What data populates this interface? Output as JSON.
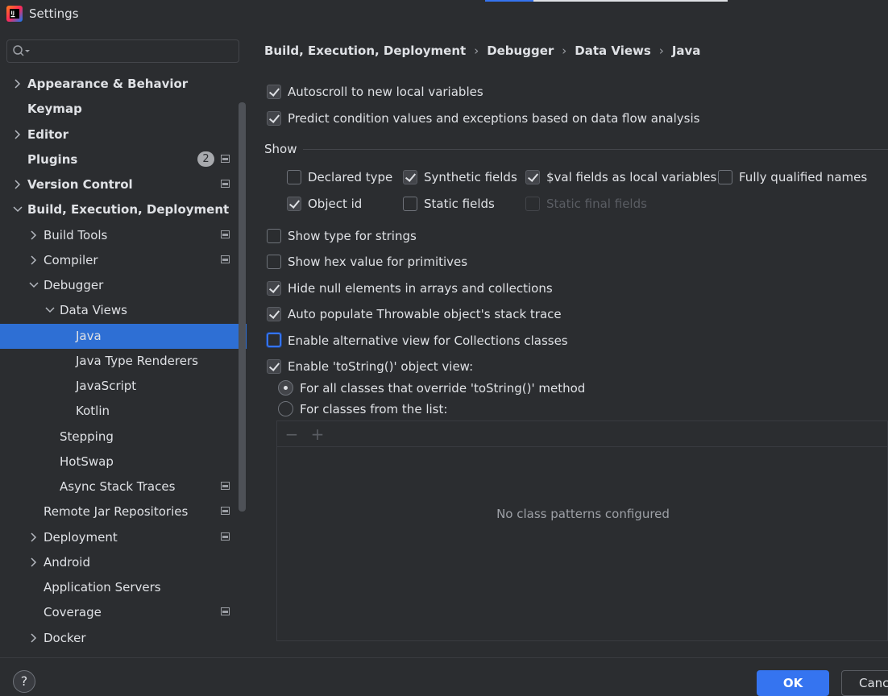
{
  "window": {
    "title": "Settings",
    "icon": "intellij-idea-icon"
  },
  "sidebar": {
    "search_placeholder": "",
    "items": [
      {
        "label": "Appearance & Behavior",
        "bold": true,
        "expandable": true,
        "expanded": false,
        "level": 0
      },
      {
        "label": "Keymap",
        "bold": true,
        "expandable": false,
        "level": 0
      },
      {
        "label": "Editor",
        "bold": true,
        "expandable": true,
        "expanded": false,
        "level": 0
      },
      {
        "label": "Plugins",
        "bold": true,
        "expandable": false,
        "level": 0,
        "badge": "2",
        "project_icon": true
      },
      {
        "label": "Version Control",
        "bold": true,
        "expandable": true,
        "expanded": false,
        "level": 0,
        "project_icon": true
      },
      {
        "label": "Build, Execution, Deployment",
        "bold": true,
        "expandable": true,
        "expanded": true,
        "level": 0
      },
      {
        "label": "Build Tools",
        "expandable": true,
        "expanded": false,
        "level": 1,
        "project_icon": true
      },
      {
        "label": "Compiler",
        "expandable": true,
        "expanded": false,
        "level": 1,
        "project_icon": true
      },
      {
        "label": "Debugger",
        "expandable": true,
        "expanded": true,
        "level": 1
      },
      {
        "label": "Data Views",
        "expandable": true,
        "expanded": true,
        "level": 2
      },
      {
        "label": "Java",
        "expandable": false,
        "level": 3,
        "selected": true
      },
      {
        "label": "Java Type Renderers",
        "expandable": false,
        "level": 3
      },
      {
        "label": "JavaScript",
        "expandable": false,
        "level": 3
      },
      {
        "label": "Kotlin",
        "expandable": false,
        "level": 3
      },
      {
        "label": "Stepping",
        "expandable": false,
        "level": 2
      },
      {
        "label": "HotSwap",
        "expandable": false,
        "level": 2
      },
      {
        "label": "Async Stack Traces",
        "expandable": false,
        "level": 2,
        "project_icon": true
      },
      {
        "label": "Remote Jar Repositories",
        "expandable": false,
        "level": 1,
        "project_icon": true
      },
      {
        "label": "Deployment",
        "expandable": true,
        "expanded": false,
        "level": 1,
        "project_icon": true
      },
      {
        "label": "Android",
        "expandable": true,
        "expanded": false,
        "level": 1
      },
      {
        "label": "Application Servers",
        "expandable": false,
        "level": 1
      },
      {
        "label": "Coverage",
        "expandable": false,
        "level": 1,
        "project_icon": true
      },
      {
        "label": "Docker",
        "expandable": true,
        "expanded": false,
        "level": 1
      }
    ]
  },
  "breadcrumb": [
    "Build, Execution, Deployment",
    "Debugger",
    "Data Views",
    "Java"
  ],
  "options_top": [
    {
      "label": "Autoscroll to new local variables",
      "checked": true
    },
    {
      "label": "Predict condition values and exceptions based on data flow analysis",
      "checked": true
    }
  ],
  "show_group": {
    "title": "Show",
    "row1": [
      {
        "label": "Declared type",
        "checked": false
      },
      {
        "label": "Synthetic fields",
        "checked": true
      },
      {
        "label": "$val fields as local variables",
        "checked": true
      },
      {
        "label": "Fully qualified names",
        "checked": false
      }
    ],
    "row2": [
      {
        "label": "Object id",
        "checked": true
      },
      {
        "label": "Static fields",
        "checked": false
      },
      {
        "label": "Static final fields",
        "checked": false,
        "disabled": true
      }
    ]
  },
  "options_bottom": [
    {
      "label": "Show type for strings",
      "checked": false
    },
    {
      "label": "Show hex value for primitives",
      "checked": false
    },
    {
      "label": "Hide null elements in arrays and collections",
      "checked": true
    },
    {
      "label": "Auto populate Throwable object's stack trace",
      "checked": true
    },
    {
      "label": "Enable alternative view for Collections classes",
      "checked": false,
      "focused": true
    },
    {
      "label": "Enable 'toString()' object view:",
      "checked": true
    }
  ],
  "tostring_radios": [
    {
      "label": "For all classes that override 'toString()' method",
      "selected": true
    },
    {
      "label": "For classes from the list:",
      "selected": false
    }
  ],
  "class_list": {
    "remove_icon": "minus-icon",
    "add_icon": "plus-icon",
    "empty_text": "No class patterns configured"
  },
  "footer": {
    "help_label": "?",
    "ok_label": "OK",
    "cancel_label": "Cancel"
  },
  "colors": {
    "background": "#2b2d30",
    "selection": "#2e6fd4",
    "accent": "#3574f0",
    "text": "#dfe1e5"
  }
}
